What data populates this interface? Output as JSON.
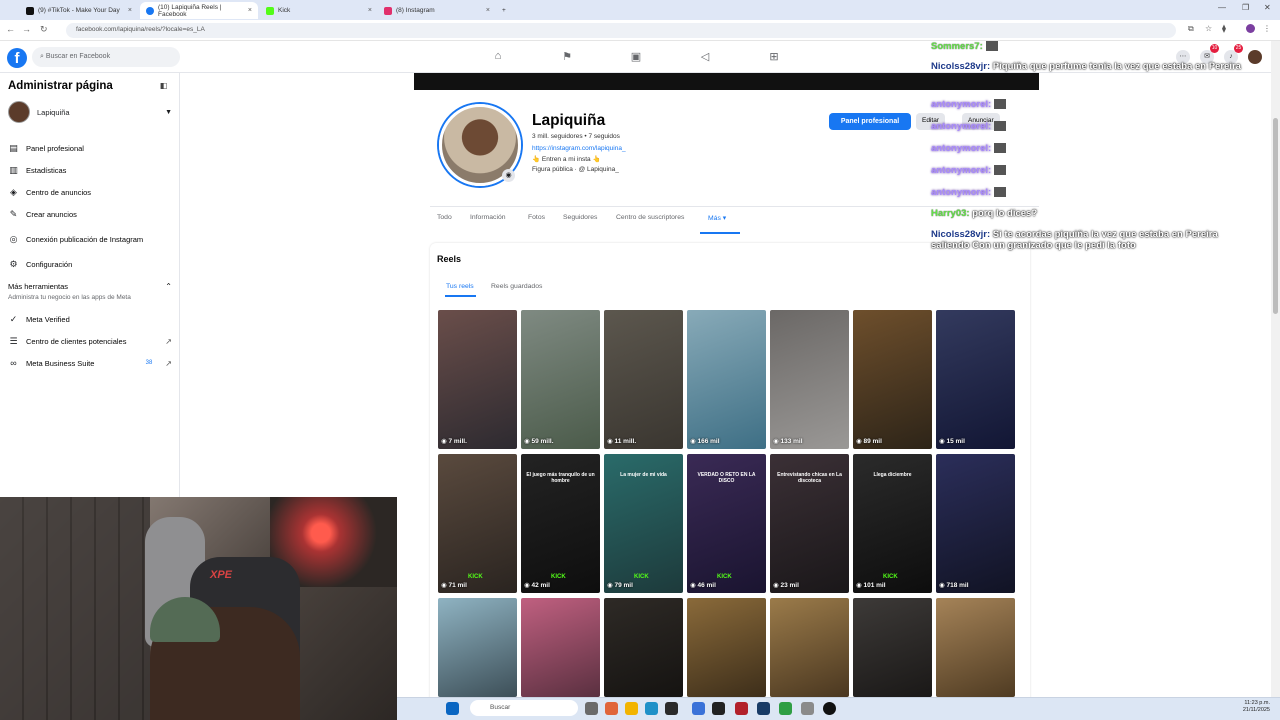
{
  "browser": {
    "tabs": [
      {
        "title": "(9) #TikTok - Make Your Day",
        "icon": "tiktok-icon",
        "color": "#111111"
      },
      {
        "title": "(10) Lapiquiña Reels | Facebook",
        "icon": "facebook-icon",
        "color": "#1877f2"
      },
      {
        "title": "Kick",
        "icon": "kick-icon",
        "color": "#53fc18"
      },
      {
        "title": "(8) Instagram",
        "icon": "instagram-icon",
        "color": "#e1306c"
      }
    ],
    "new_tab": "+",
    "url": "facebook.com/lapiquina/reels/?locale=es_LA"
  },
  "facebook": {
    "search_placeholder": "Buscar en Facebook",
    "notifications_badge": "25",
    "messages_badge": "10",
    "sidebar": {
      "title": "Administrar página",
      "page_name": "Lapiquiña",
      "items": [
        {
          "label": "Panel profesional",
          "icon": "dashboard-icon"
        },
        {
          "label": "Estadísticas",
          "icon": "insights-icon"
        },
        {
          "label": "Centro de anuncios",
          "icon": "ads-center-icon"
        },
        {
          "label": "Crear anuncios",
          "icon": "create-ad-icon"
        },
        {
          "label": "Conexión publicación de Instagram",
          "icon": "instagram-icon"
        },
        {
          "label": "Configuración",
          "icon": "settings-icon"
        }
      ],
      "tools_title": "Más herramientas",
      "tools_subtitle": "Administra tu negocio en las apps de Meta",
      "tools": [
        {
          "label": "Meta Verified",
          "icon": "verified-icon",
          "badge": ""
        },
        {
          "label": "Centro de clientes potenciales",
          "icon": "leads-icon",
          "badge": ""
        },
        {
          "label": "Meta Business Suite",
          "icon": "business-suite-icon",
          "badge": "38"
        }
      ]
    },
    "profile": {
      "name": "Lapiquiña",
      "stats": "3 mill. seguidores • 7 seguidos",
      "link": "https://instagram.com/lapiquina_",
      "bio": "👆 Entren a mi insta 👆",
      "category": "Figura pública · @ Lapiquina_",
      "panel_button": "Panel profesional",
      "edit_button": "Editar",
      "promote_button": "Anunciar"
    },
    "page_tabs": [
      "Todo",
      "Información",
      "Fotos",
      "Seguidores",
      "Centro de suscriptores",
      "Más ▾"
    ],
    "reels": {
      "title": "Reels",
      "tabs": [
        "Tus reels",
        "Reels guardados"
      ],
      "items": [
        {
          "views": "7 mill.",
          "caption": "",
          "kick": "",
          "colors": [
            "#6a4e4a",
            "#2d2a30"
          ]
        },
        {
          "views": "59 mill.",
          "caption": "",
          "kick": "",
          "colors": [
            "#7f8a82",
            "#4b5b4a"
          ]
        },
        {
          "views": "11 mill.",
          "caption": "",
          "kick": "",
          "colors": [
            "#5c574e",
            "#3a3630"
          ]
        },
        {
          "views": "166 mil",
          "caption": "",
          "kick": "",
          "colors": [
            "#88aab8",
            "#3e6f85"
          ]
        },
        {
          "views": "133 mil",
          "caption": "",
          "kick": "",
          "colors": [
            "#6b6866",
            "#9a9896"
          ]
        },
        {
          "views": "89 mil",
          "caption": "",
          "kick": "",
          "colors": [
            "#6e4f2c",
            "#2d2418"
          ]
        },
        {
          "views": "15 mil",
          "caption": "",
          "kick": "",
          "colors": [
            "#333a5e",
            "#121634"
          ]
        },
        {
          "views": "71 mil",
          "caption": "",
          "kick": "KICK",
          "colors": [
            "#5a4a3e",
            "#2a2420"
          ]
        },
        {
          "views": "42 mil",
          "caption": "El juego más tranquilo de un hombre",
          "kick": "KICK",
          "colors": [
            "#232323",
            "#0e0e0e"
          ]
        },
        {
          "views": "79 mil",
          "caption": "La mujer de mi vida",
          "kick": "KICK",
          "colors": [
            "#2a6b6a",
            "#1d3a3b"
          ]
        },
        {
          "views": "46 mil",
          "caption": "VERDAD O RETO EN LA DISCO",
          "kick": "KICK",
          "colors": [
            "#3a2a55",
            "#1a1430"
          ]
        },
        {
          "views": "23 mil",
          "caption": "Entrevistando chicas en La discoteca",
          "kick": "",
          "colors": [
            "#3b3036",
            "#1a1719"
          ]
        },
        {
          "views": "101 mil",
          "caption": "Llega diciembre",
          "kick": "KICK",
          "colors": [
            "#2b2b2b",
            "#0d0d0d"
          ]
        },
        {
          "views": "718 mil",
          "caption": "",
          "kick": "",
          "colors": [
            "#2b2e5a",
            "#111324"
          ]
        },
        {
          "views": "",
          "caption": "",
          "kick": "",
          "colors": [
            "#8fb3c2",
            "#3d4f58"
          ]
        },
        {
          "views": "",
          "caption": "",
          "kick": "",
          "colors": [
            "#c06080",
            "#5a3040"
          ]
        },
        {
          "views": "",
          "caption": "",
          "kick": "",
          "colors": [
            "#2e2a26",
            "#151311"
          ]
        },
        {
          "views": "",
          "caption": "",
          "kick": "",
          "colors": [
            "#8a6a3a",
            "#3d2e1a"
          ]
        },
        {
          "views": "",
          "caption": "",
          "kick": "",
          "colors": [
            "#9b7b4a",
            "#4a3720"
          ]
        },
        {
          "views": "",
          "caption": "",
          "kick": "",
          "colors": [
            "#3d3a38",
            "#1a1817"
          ]
        },
        {
          "views": "",
          "caption": "",
          "kick": "",
          "colors": [
            "#a58358",
            "#4f3b22"
          ]
        }
      ]
    }
  },
  "chat": [
    {
      "user": "Sommers7:",
      "text": "",
      "emote": true,
      "style": "green"
    },
    {
      "user": "Nicolss28vjr:",
      "text": "Piquiña que perfume tenía la vez que estaba en Pereira",
      "emote": false,
      "style": "blue"
    },
    {
      "user": "antonymorel:",
      "text": "",
      "emote": true,
      "style": "purple"
    },
    {
      "user": "antonymorel:",
      "text": "",
      "emote": true,
      "style": "purple"
    },
    {
      "user": "antonymorel:",
      "text": "",
      "emote": true,
      "style": "purple"
    },
    {
      "user": "antonymorel:",
      "text": "",
      "emote": true,
      "style": "purple"
    },
    {
      "user": "antonymorel:",
      "text": "",
      "emote": true,
      "style": "purple"
    },
    {
      "user": "Harry03:",
      "text": "porq lo dices?",
      "emote": false,
      "style": "green"
    },
    {
      "user": "Nicolss28vjr:",
      "text": "Si te acordas piquiña la vez que estaba en Pereira saliendo Con un granizado que le pedí la foto",
      "emote": false,
      "style": "blue"
    }
  ],
  "webcam": {
    "chair_brand": "XPE"
  },
  "taskbar": {
    "search_placeholder": "Buscar",
    "time": "11:23 p.m.",
    "date": "21/11/2025"
  }
}
